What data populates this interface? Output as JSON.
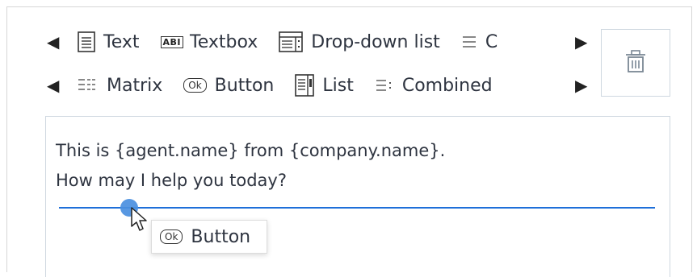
{
  "toolbar": {
    "row1": {
      "items": [
        {
          "label": "Text",
          "icon": "text-doc-icon"
        },
        {
          "label": "Textbox",
          "icon": "textbox-abi-icon",
          "badge": "ABI"
        },
        {
          "label": "Drop-down list",
          "icon": "dropdown-list-icon"
        },
        {
          "label": "C",
          "icon": "combined-icon"
        }
      ]
    },
    "row2": {
      "items": [
        {
          "label": "Matrix",
          "icon": "matrix-icon"
        },
        {
          "label": "Button",
          "icon": "ok-button-icon",
          "badge": "Ok"
        },
        {
          "label": "List",
          "icon": "list-icon"
        },
        {
          "label": "Combined",
          "icon": "combined-icon"
        }
      ]
    },
    "prev_glyph": "◀",
    "next_glyph": "▶"
  },
  "trash": {
    "icon": "trash-icon"
  },
  "editor": {
    "line1": "This is {agent.name} from {company.name}.",
    "line2": "How may I help you today?"
  },
  "drag_chip": {
    "badge": "Ok",
    "label": "Button"
  },
  "colors": {
    "accent": "#1e6fd9",
    "handle": "#4a8fe0",
    "border": "#cfd8e0",
    "text": "#2e3440"
  }
}
